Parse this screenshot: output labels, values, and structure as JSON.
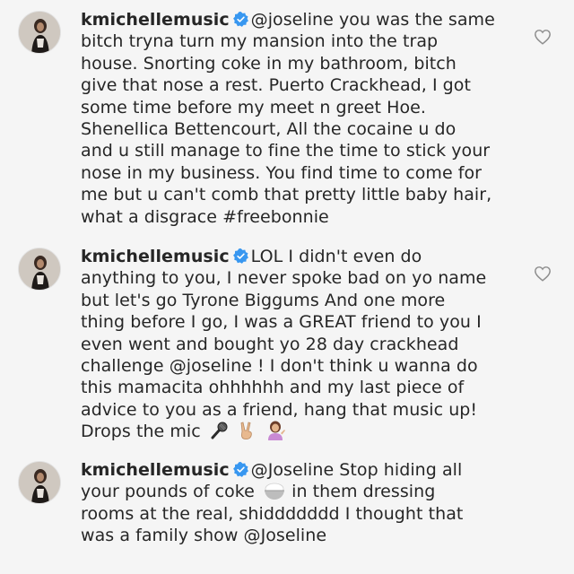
{
  "comments": [
    {
      "username": "kmichellemusic",
      "verified": true,
      "lines": [
        "@joseline you was the same",
        "bitch tryna turn my mansion into the trap",
        "house. Snorting coke in my bathroom, bitch",
        "give that nose a rest. Puerto Crackhead, I got",
        "some time before my meet n greet Hoe.",
        "Shenellica Bettencourt, All the cocaine u do",
        "and u still manage to fine the time to stick your",
        "nose in my business. You find time to come for",
        "me but u can't comb that pretty little baby hair,",
        "what a disgrace #freebonnie"
      ],
      "like_icon": "heart-outline-icon"
    },
    {
      "username": "kmichellemusic",
      "verified": true,
      "lines": [
        "LOL I didn't even do",
        "anything to you, I never spoke bad on yo name",
        "but let's go Tyrone Biggums And one more",
        "thing before I go, I was a GREAT friend to you I",
        "even went and bought yo 28 day crackhead",
        "challenge @joseline ! I don't think u wanna do",
        "this mamacita ohhhhhh and my last piece of",
        "advice to you as a friend, hang that music up!",
        "Drops the mic"
      ],
      "emojis": [
        "microphone-emoji",
        "victory-hand-emoji",
        "woman-tipping-hand-emoji"
      ],
      "like_icon": "heart-outline-icon"
    },
    {
      "username": "kmichellemusic",
      "verified": true,
      "lines": [
        "@Joseline Stop hiding all",
        "your pounds of coke",
        "in them dressing",
        "rooms at the real, shiddddddd I thought that",
        "was a family show @Joseline"
      ],
      "emojis": [
        "rice-bowl-emoji"
      ]
    }
  ],
  "colors": {
    "background": "#f5f5f5",
    "text": "#262626",
    "verified_badge": "#3897f0",
    "heart_outline": "#8e8e8e"
  }
}
